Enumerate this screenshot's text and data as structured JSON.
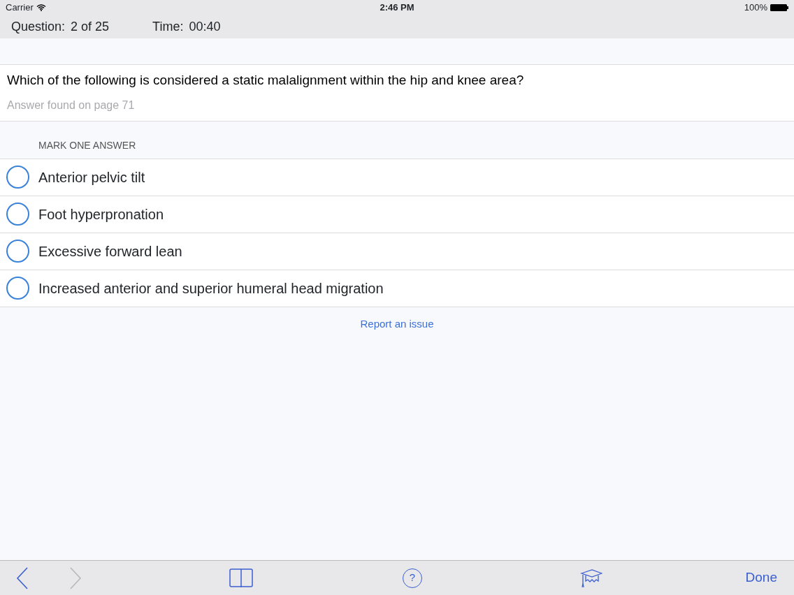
{
  "status_bar": {
    "carrier": "Carrier",
    "time": "2:46 PM",
    "battery": "100%"
  },
  "header": {
    "question_label": "Question:",
    "question_value": "2 of 25",
    "time_label": "Time:",
    "time_value": "00:40"
  },
  "question": {
    "text": "Which of the following is considered a static malalignment within the hip and knee area?",
    "hint": "Answer found on page 71"
  },
  "answers": {
    "heading": "MARK ONE ANSWER",
    "options": [
      {
        "label": "Anterior pelvic tilt",
        "selected": false
      },
      {
        "label": "Foot hyperpronation",
        "selected": false
      },
      {
        "label": "Excessive forward lean",
        "selected": false
      },
      {
        "label": "Increased anterior and superior humeral head migration",
        "selected": false
      }
    ]
  },
  "report_link": "Report an issue",
  "toolbar": {
    "back_disabled": false,
    "forward_disabled": true,
    "help": "?",
    "done": "Done"
  }
}
